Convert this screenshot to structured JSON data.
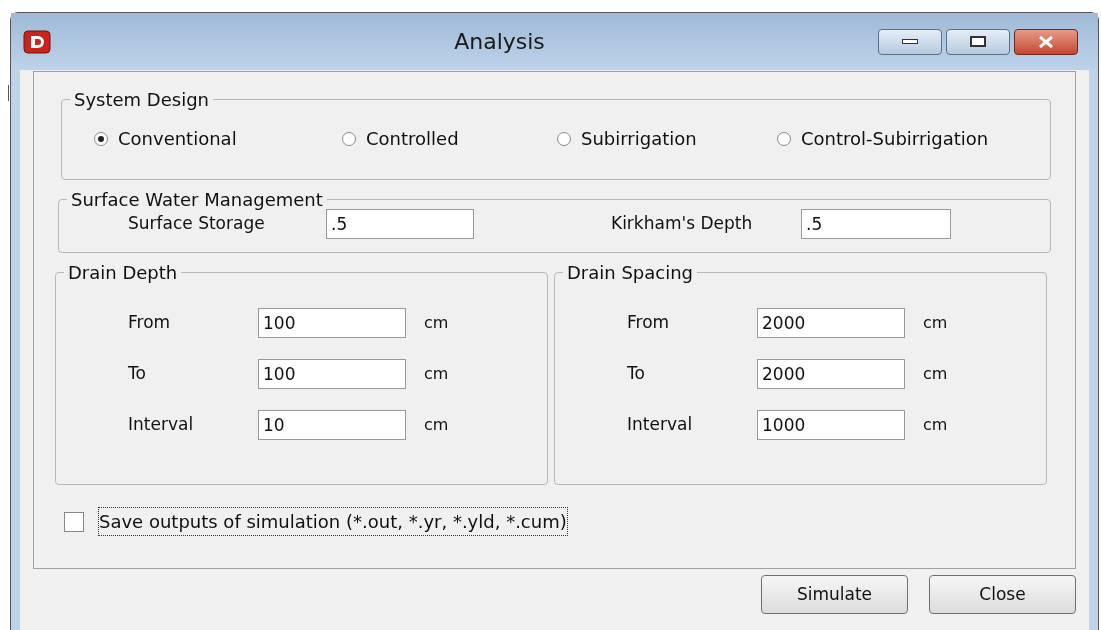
{
  "window": {
    "title": "Analysis"
  },
  "system_design": {
    "title": "System Design",
    "options": [
      {
        "label": "Conventional",
        "selected": true
      },
      {
        "label": "Controlled",
        "selected": false
      },
      {
        "label": "Subirrigation",
        "selected": false
      },
      {
        "label": "Control-Subirrigation",
        "selected": false
      }
    ]
  },
  "surface_water": {
    "title": "Surface Water Management",
    "fields": [
      {
        "label": "Surface Storage",
        "value": ".5"
      },
      {
        "label": "Kirkham's Depth",
        "value": ".5"
      }
    ]
  },
  "drain_groups": [
    {
      "title": "Drain Depth",
      "rows": [
        {
          "label": "From",
          "value": "100",
          "unit": "cm"
        },
        {
          "label": "To",
          "value": "100",
          "unit": "cm"
        },
        {
          "label": "Interval",
          "value": "10",
          "unit": "cm"
        }
      ]
    },
    {
      "title": "Drain Spacing",
      "rows": [
        {
          "label": "From",
          "value": "2000",
          "unit": "cm"
        },
        {
          "label": "To",
          "value": "2000",
          "unit": "cm"
        },
        {
          "label": "Interval",
          "value": "1000",
          "unit": "cm"
        }
      ]
    }
  ],
  "save_outputs": {
    "label": "Save outputs of simulation (*.out, *.yr, *.yld, *.cum)",
    "checked": false
  },
  "buttons": [
    "Simulate",
    "Close"
  ]
}
